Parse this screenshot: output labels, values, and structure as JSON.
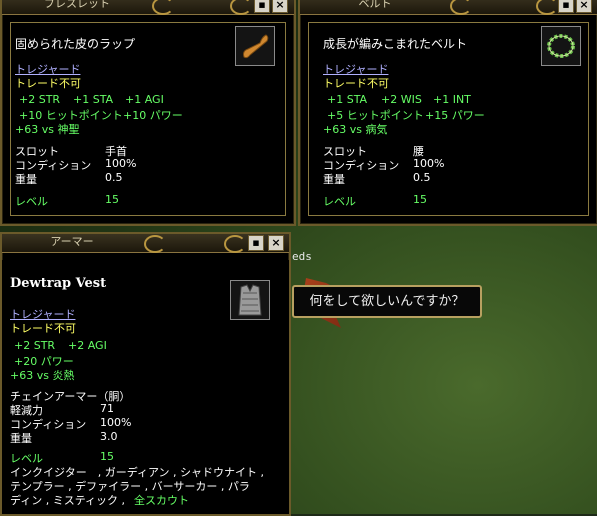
{
  "world": {
    "bg_text": "eds"
  },
  "bracelet": {
    "title": "ブレスレット",
    "item_name": "固められた皮のラップ",
    "icon": "leather-wrap-icon",
    "treasure": "トレジャード",
    "no_trade": "トレード不可",
    "stats": [
      "+2 STR",
      "+1 STA",
      "+1 AGI"
    ],
    "stats2": [
      "+10 ヒットポイント",
      "+10 パワー"
    ],
    "resist": "+63 vs 神聖",
    "slot_label": "スロット",
    "slot_value": "手首",
    "cond_label": "コンディション",
    "cond_value": "100%",
    "weight_label": "重量",
    "weight_value": "0.5",
    "level_label": "レベル",
    "level_value": "15"
  },
  "belt": {
    "title": "ベルト",
    "item_name": "成長が編みこまれたベルト",
    "icon": "woven-belt-icon",
    "treasure": "トレジャード",
    "no_trade": "トレード不可",
    "stats": [
      "+1 STA",
      "+2 WIS",
      "+1 INT"
    ],
    "stats2": [
      "+5 ヒットポイント",
      "+15 パワー"
    ],
    "resist": "+63 vs 病気",
    "slot_label": "スロット",
    "slot_value": "腰",
    "cond_label": "コンディション",
    "cond_value": "100%",
    "weight_label": "重量",
    "weight_value": "0.5",
    "level_label": "レベル",
    "level_value": "15"
  },
  "armor": {
    "title": "アーマー",
    "item_name": "Dewtrap Vest",
    "icon": "chainmail-vest-icon",
    "treasure": "トレジャード",
    "no_trade": "トレード不可",
    "stats": [
      "+2 STR",
      "+2 AGI"
    ],
    "stats2": [
      "+20 パワー"
    ],
    "resist": "+63 vs 炎熱",
    "type_line": "チェインアーマー（胴）",
    "mit_label": "軽減力",
    "mit_value": "71",
    "cond_label": "コンディション",
    "cond_value": "100%",
    "weight_label": "重量",
    "weight_value": "3.0",
    "level_label": "レベル",
    "level_value": "15",
    "classes1": "インクイジター　, ガーディアン , シャドウナイト ,",
    "classes2": "テンプラー , デファイラー , バーサーカー , パラ",
    "classes3": "ディン , ミスティック ,",
    "classes3b": "全スカウト"
  },
  "speech": {
    "text": "何をして欲しいんですか？"
  },
  "colors": {
    "frame": "#6b5a2a",
    "stat_green": "#66ff66",
    "treasure_blue": "#b0b0ff",
    "notrade_yellow": "#ffff66"
  }
}
